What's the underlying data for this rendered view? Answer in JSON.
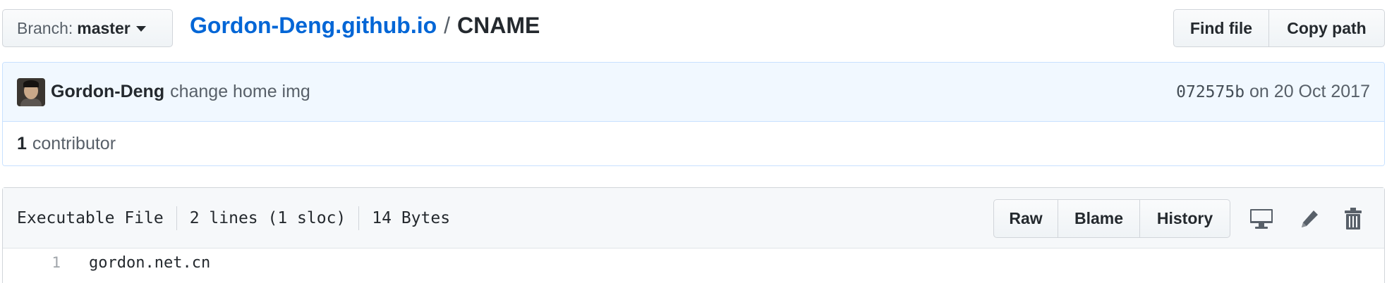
{
  "branch": {
    "prefix": "Branch:",
    "name": "master"
  },
  "breadcrumb": {
    "repo": "Gordon-Deng.github.io",
    "separator": "/",
    "file": "CNAME"
  },
  "top_actions": {
    "find_file": "Find file",
    "copy_path": "Copy path"
  },
  "commit": {
    "author": "Gordon-Deng",
    "message": "change home img",
    "sha": "072575b",
    "date": "on 20 Oct 2017"
  },
  "contributors": {
    "count": "1",
    "label": "contributor"
  },
  "file": {
    "mode": "Executable File",
    "lines": "2 lines (1 sloc)",
    "size": "14 Bytes",
    "actions": {
      "raw": "Raw",
      "blame": "Blame",
      "history": "History"
    },
    "icons": [
      "desktop-icon",
      "pencil-icon",
      "trash-icon"
    ],
    "code": [
      {
        "num": "1",
        "text": "gordon.net.cn"
      }
    ]
  },
  "colors": {
    "link": "#0366d6",
    "commit_bg": "#f1f8ff",
    "commit_border": "#c8e1ff"
  }
}
